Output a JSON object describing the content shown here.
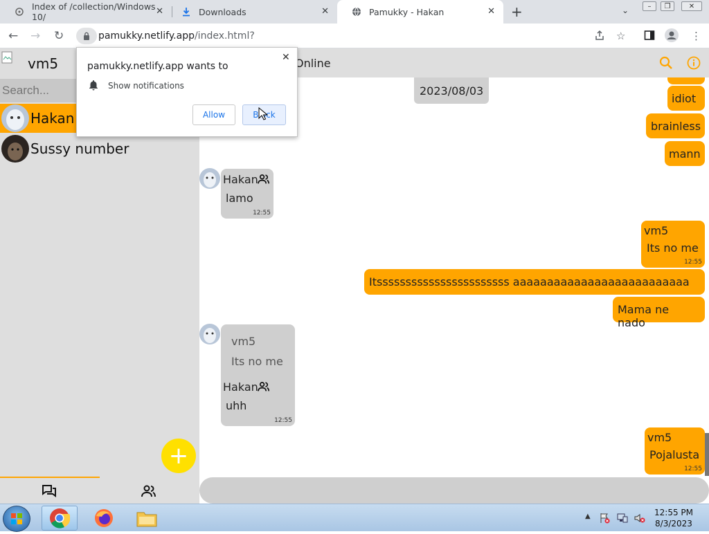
{
  "browser": {
    "tabs": [
      {
        "title": "Index of /collection/Windows 10/",
        "active": false
      },
      {
        "title": "Downloads",
        "active": false
      },
      {
        "title": "Pamukky - Hakan",
        "active": true
      }
    ],
    "url_host": "pamukky.netlify.app",
    "url_path": "/index.html?"
  },
  "permission_popup": {
    "title": "pamukky.netlify.app wants to",
    "permission": "Show notifications",
    "allow_label": "Allow",
    "block_label": "Block"
  },
  "sidebar": {
    "username": "vm5",
    "search_placeholder": "Search...",
    "contacts": [
      {
        "name": "Hakan",
        "selected": true
      },
      {
        "name": "Sussy number",
        "selected": false
      }
    ]
  },
  "chat": {
    "status": "Online",
    "date": "2023/08/03",
    "messages": [
      {
        "dir": "sent",
        "text": "idiot"
      },
      {
        "dir": "sent",
        "text": "brainless"
      },
      {
        "dir": "sent",
        "text": "mann"
      },
      {
        "dir": "recv",
        "sender": "Hakan",
        "text": "lamo",
        "time": "12:55"
      },
      {
        "dir": "sent",
        "sender": "vm5",
        "text": "Its no me",
        "time": "12:55"
      },
      {
        "dir": "sent",
        "text": "Itsssssssssssssssssssssss aaaaaaaaaaaaaaaaaaaaaaaaaa"
      },
      {
        "dir": "sent",
        "text": "Mama ne nado"
      },
      {
        "dir": "recv",
        "reply_sender": "vm5",
        "reply_text": "Its no me",
        "sender": "Hakan",
        "text": "uhh",
        "time": "12:55"
      },
      {
        "dir": "sent",
        "sender": "vm5",
        "text": "Pojalusta",
        "time": "12:55"
      }
    ]
  },
  "colors": {
    "accent": "#ffa500",
    "fab": "#ffe000",
    "panel": "#dedede",
    "bubble_recv": "#cfcfcf"
  },
  "taskbar": {
    "time": "12:55 PM",
    "date": "8/3/2023"
  }
}
